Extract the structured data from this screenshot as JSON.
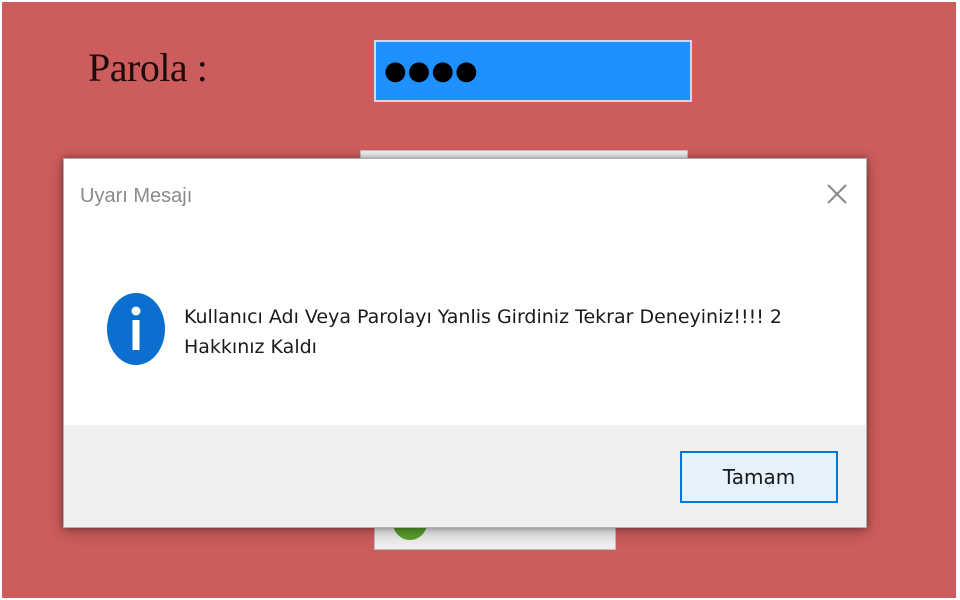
{
  "login_form": {
    "password_label": "Parola :",
    "password_value": "●●●●",
    "colors": {
      "background": "#cd5c5c",
      "password_field": "#1e90ff"
    }
  },
  "dialog": {
    "title": "Uyarı Mesajı",
    "icon": "info-icon",
    "message_line1": "Kullanıcı Adı Veya Parolayı Yanlis Girdiniz Tekrar Deneyiniz!!!!  2",
    "message_line2": "Hakkınız Kaldı",
    "ok_label": "Tamam",
    "colors": {
      "icon": "#0a6fce",
      "ok_border": "#0078d7"
    }
  }
}
